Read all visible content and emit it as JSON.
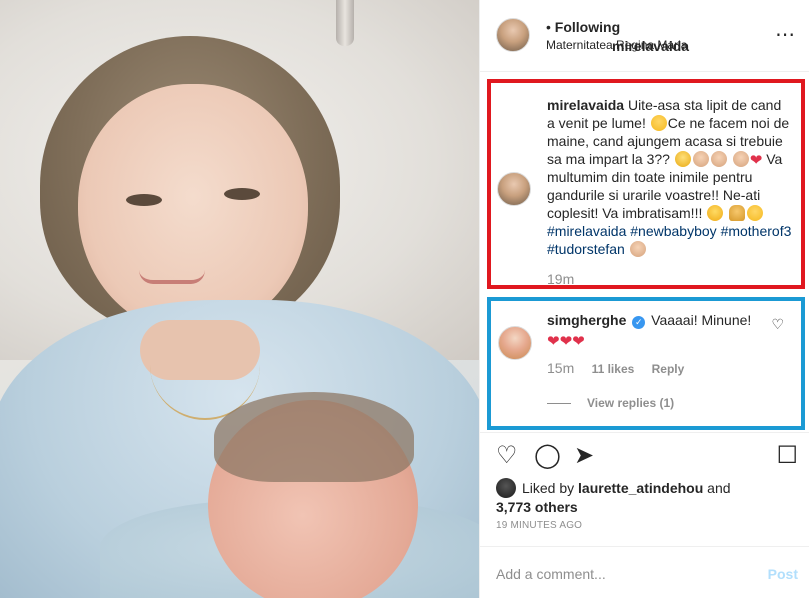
{
  "post": {
    "username": "mirelavaida",
    "dot": "•",
    "following": "Following",
    "location": "Maternitatea Regina Maria"
  },
  "caption": {
    "username": "mirelavaida",
    "p1": " Uite-asa sta lipit de cand a venit pe lume! ",
    "p2": "Ce ne facem noi de maine, cand ajungem acasa si trebuie sa ma impart la 3?? ",
    "p3": " Va multumim din toate inimile pentru gandurile si urarile voastre!! Ne-ati coplesit! Va imbratisam!!! ",
    "tag1": "#mirelavaida",
    "tag2": "#newbabyboy",
    "tag3": "#motherof3",
    "tag4": "#tudorstefan",
    "time": "19m"
  },
  "comment": {
    "username": "simgherghe",
    "text": "Vaaaai! Minune!",
    "time": "15m",
    "likes": "11 likes",
    "reply": "Reply",
    "view_replies": "View replies (1)"
  },
  "likes": {
    "prefix": "Liked by ",
    "user": "laurette_atindehou",
    "and": " and",
    "others": "3,773 others"
  },
  "posted_ago": "19 MINUTES AGO",
  "add_comment": {
    "placeholder": "Add a comment...",
    "post_label": "Post"
  },
  "colors": {
    "red_highlight": "#e0181f",
    "blue_highlight": "#1b9ad4",
    "link": "#003569"
  }
}
